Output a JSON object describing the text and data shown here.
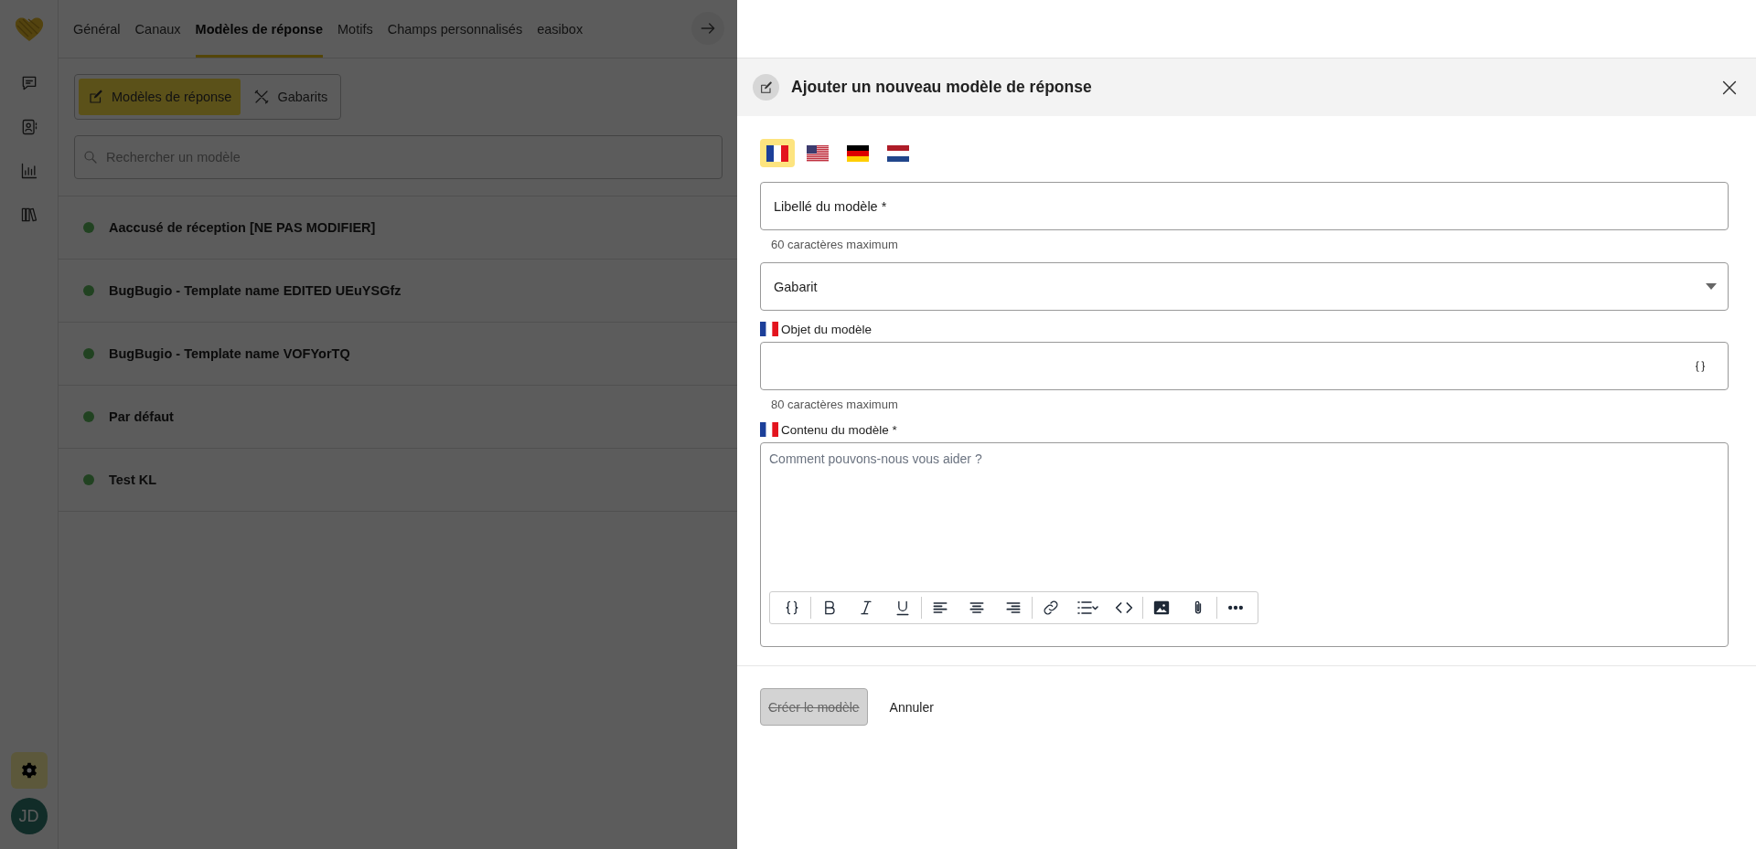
{
  "sidebar": {
    "items": [
      {
        "kind": "chat",
        "selected": false
      },
      {
        "kind": "contacts",
        "selected": false
      },
      {
        "kind": "stats",
        "selected": false
      },
      {
        "kind": "library",
        "selected": false
      },
      {
        "kind": "settings",
        "selected": true
      }
    ],
    "avatar": "JD"
  },
  "nav_tabs": [
    {
      "label": "Général",
      "selected": false
    },
    {
      "label": "Canaux",
      "selected": false
    },
    {
      "label": "Modèles de réponse",
      "selected": true
    },
    {
      "label": "Motifs",
      "selected": false
    },
    {
      "label": "Champs personnalisés",
      "selected": false
    },
    {
      "label": "easibox",
      "selected": false
    }
  ],
  "sub_tabs": [
    {
      "label": "Modèles de réponse",
      "kind": "edit",
      "selected": true
    },
    {
      "label": "Gabarits",
      "kind": "tools",
      "selected": false
    }
  ],
  "search": {
    "placeholder": "Rechercher un modèle"
  },
  "templates": [
    {
      "name": "Aaccusé de réception [NE PAS MODIFIER]",
      "active": true
    },
    {
      "name": "BugBugio - Template name EDITED UEuYSGfz",
      "active": true
    },
    {
      "name": "BugBugio - Template name VOFYorTQ",
      "active": true
    },
    {
      "name": "Par défaut",
      "active": true
    },
    {
      "name": "Test KL",
      "active": true
    }
  ],
  "drawer": {
    "title": "Ajouter un nouveau modèle de réponse",
    "languages": [
      {
        "kind": "fr",
        "selected": true
      },
      {
        "kind": "us",
        "selected": false
      },
      {
        "kind": "de",
        "selected": false
      },
      {
        "kind": "nl",
        "selected": false
      }
    ],
    "fields": [
      {
        "kind": "text",
        "label": "Libellé du modèle *",
        "helper": "60 caractères maximum"
      },
      {
        "kind": "select",
        "label": "Gabarit"
      },
      {
        "kind": "subject",
        "flagged": true,
        "label": "Objet du modèle",
        "helper": "80 caractères maximum"
      },
      {
        "kind": "editor",
        "flagged": true,
        "label": "Contenu du modèle *",
        "placeholder": "Comment pouvons-nous vous aider ?"
      }
    ],
    "toolbar": [
      {
        "kind": "variable"
      },
      {
        "kind": "sep"
      },
      {
        "kind": "bold"
      },
      {
        "kind": "italic"
      },
      {
        "kind": "underline"
      },
      {
        "kind": "sep"
      },
      {
        "kind": "align-left"
      },
      {
        "kind": "align-center"
      },
      {
        "kind": "align-right"
      },
      {
        "kind": "sep"
      },
      {
        "kind": "link"
      },
      {
        "kind": "list"
      },
      {
        "kind": "code"
      },
      {
        "kind": "sep"
      },
      {
        "kind": "image"
      },
      {
        "kind": "attach"
      },
      {
        "kind": "sep"
      },
      {
        "kind": "more"
      }
    ],
    "buttons": [
      {
        "label": "Créer le modèle",
        "kind": "primary",
        "disabled": true
      },
      {
        "label": "Annuler",
        "kind": "link",
        "disabled": false
      }
    ]
  }
}
